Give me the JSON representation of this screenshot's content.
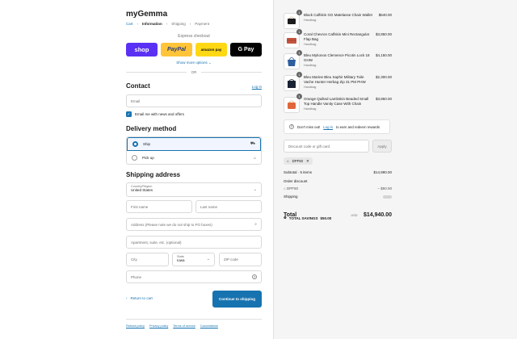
{
  "store": {
    "name": "myGemma"
  },
  "breadcrumb": [
    "Cart",
    "Information",
    "Shipping",
    "Payment"
  ],
  "express": {
    "title": "Express checkout",
    "shop": "shop",
    "paypal": "PayPal",
    "amazon": "amazon pay",
    "gpay": "G Pay",
    "show_more": "Show more options",
    "or": "OR"
  },
  "contact": {
    "heading": "Contact",
    "login": "Log in",
    "email_placeholder": "Email",
    "news_label": "Email me with news and offers",
    "news_checked": true
  },
  "delivery": {
    "heading": "Delivery method",
    "ship": "Ship",
    "pickup": "Pick up",
    "selected": "Ship"
  },
  "shipping": {
    "heading": "Shipping address",
    "country_label": "Country/Region",
    "country_value": "United States",
    "first_name": "First name",
    "last_name": "Last name",
    "address": "Address (Please note we do not ship to PO boxes)",
    "apartment": "Apartment, suite, etc. (optional)",
    "city": "City",
    "state_label": "State",
    "state_value": "Iowa",
    "zip": "ZIP code",
    "phone": "Phone"
  },
  "actions": {
    "return": "Return to cart",
    "continue": "Continue to shipping"
  },
  "footer": [
    "Refund policy",
    "Privacy policy",
    "Terms of service",
    "Cancelations"
  ],
  "products": [
    {
      "name": "Black Calfskin GG Matelasse Chain Wallet",
      "variant": "Handbag",
      "price": "$640.00",
      "qty": "1",
      "color": "#1c1c1c"
    },
    {
      "name": "Coral Chevron Calfskin Mini Rectangular Flap Bag",
      "variant": "Handbag",
      "price": "$3,850.00",
      "qty": "1",
      "color": "#c4553f"
    },
    {
      "name": "Bleu Mykonos Clemence Picotin Lock 18 GHW",
      "variant": "Handbag",
      "price": "$4,150.00",
      "qty": "1",
      "color": "#2f5e9e"
    },
    {
      "name": "Bleu Marine Bleu Saphir Military Toile Vache Hunter Herbag Zip 31 PM PHW",
      "variant": "Handbag",
      "price": "$2,300.00",
      "qty": "1",
      "color": "#1a2335"
    },
    {
      "name": "Orange Quilted Lambskin Beaded Small Top Handle Vanity Case With Chain",
      "variant": "Handbag",
      "price": "$3,850.00",
      "qty": "1",
      "color": "#e0673a"
    }
  ],
  "rewards": {
    "text": "Don't miss out!",
    "link": "Log in",
    "rest": "to earn and redeem rewards"
  },
  "discount": {
    "placeholder": "Discount code or gift card",
    "apply": "Apply",
    "code": "DPF50"
  },
  "summary": {
    "subtotal_label": "Subtotal · 5 items",
    "subtotal_value": "$14,990.00",
    "order_discount_label": "Order discount",
    "code_label": "DPF50",
    "code_value": "− $50.00",
    "shipping_label": "Shipping",
    "total_label": "Total",
    "currency": "USD",
    "total_value": "$14,940.00",
    "savings_label": "TOTAL SAVINGS",
    "savings_value": "$50.00"
  },
  "colors": {
    "accent": "#1773b0",
    "shop": "#5a31f4",
    "paypal": "#ffc439",
    "amazon": "#ffd814"
  }
}
